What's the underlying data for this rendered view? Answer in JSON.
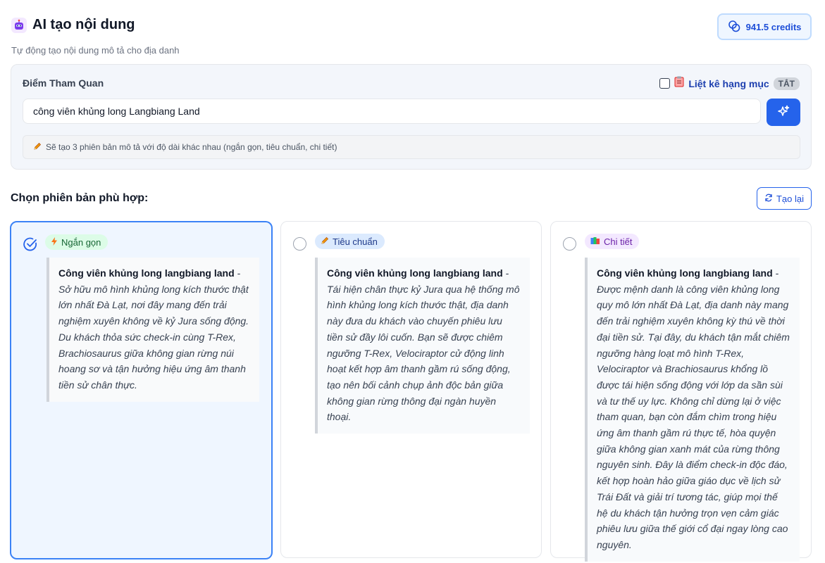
{
  "header": {
    "title": "AI tạo nội dung",
    "subtitle": "Tự động tạo nội dung mô tả cho địa danh"
  },
  "credits": {
    "label": "941.5 credits"
  },
  "form": {
    "field_label": "Điểm Tham Quan",
    "list_toggle_label": "Liệt kê hạng mục",
    "list_toggle_state": "TẮT",
    "search_value": "công viên khủng long Langbiang Land",
    "info_text": "Sẽ tạo 3 phiên bản mô tả với độ dài khác nhau (ngắn gọn, tiêu chuẩn, chi tiết)"
  },
  "results": {
    "choose_label": "Chọn phiên bản phù hợp:",
    "regenerate_label": "Tạo lại",
    "cards": [
      {
        "tag": "Ngắn gọn",
        "selected": true,
        "title": "Công viên khủng long langbiang land",
        "body": " - Sở hữu mô hình khủng long kích thước thật lớn nhất Đà Lạt, nơi đây mang đến trải nghiệm xuyên không về kỷ Jura sống động. Du khách thỏa sức check-in cùng T-Rex, Brachiosaurus giữa không gian rừng núi hoang sơ và tận hưởng hiệu ứng âm thanh tiền sử chân thực."
      },
      {
        "tag": "Tiêu chuẩn",
        "selected": false,
        "title": "Công viên khủng long langbiang land",
        "body": " - Tái hiện chân thực kỷ Jura qua hệ thống mô hình khủng long kích thước thật, địa danh này đưa du khách vào chuyến phiêu lưu tiền sử đầy lôi cuốn. Bạn sẽ được chiêm ngưỡng T-Rex, Velociraptor cử động linh hoạt kết hợp âm thanh gầm rú sống động, tạo nên bối cảnh chụp ảnh độc bản giữa không gian rừng thông đại ngàn huyền thoại."
      },
      {
        "tag": "Chi tiết",
        "selected": false,
        "title": "Công viên khủng long langbiang land",
        "body": " - Được mệnh danh là công viên khủng long quy mô lớn nhất Đà Lạt, địa danh này mang đến trải nghiệm xuyên không kỳ thú về thời đại tiền sử. Tại đây, du khách tận mắt chiêm ngưỡng hàng loạt mô hình T-Rex, Velociraptor và Brachiosaurus khổng lồ được tái hiện sống động với lớp da sần sùi và tư thế uy lực. Không chỉ dừng lại ở việc tham quan, bạn còn đắm chìm trong hiệu ứng âm thanh gầm rú thực tế, hòa quyện giữa không gian xanh mát của rừng thông nguyên sinh. Đây là điểm check-in độc đáo, kết hợp hoàn hảo giữa giáo dục về lịch sử Trái Đất và giải trí tương tác, giúp mọi thế hệ du khách tận hưởng trọn vẹn cảm giác phiêu lưu giữa thế giới cổ đại ngay lòng cao nguyên."
      }
    ]
  },
  "icons": {
    "header": "robot-icon",
    "credits": "coins-icon",
    "list_toggle": "clipboard-icon",
    "generate": "sparkles-icon",
    "info": "pencil-icon",
    "regenerate": "refresh-icon",
    "selected": "check-circle-icon",
    "tags": [
      "lightning-icon",
      "pencil-icon",
      "books-icon"
    ]
  },
  "colors": {
    "accent": "#2563eb",
    "selected_border": "#3b82f6",
    "tag_green": "#dcfce7",
    "tag_blue": "#dbeafe",
    "tag_purple": "#f3e8ff"
  }
}
